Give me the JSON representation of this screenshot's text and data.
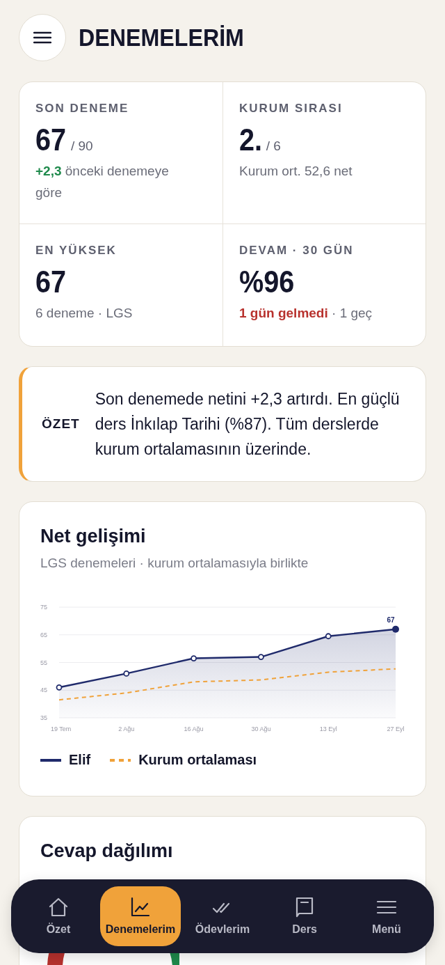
{
  "header": {
    "title": "DENEMELERİM"
  },
  "stats": [
    {
      "label": "SON DENEME",
      "value": "67",
      "suffix": "/ 90",
      "note": {
        "good": "+2,3",
        "text": "önceki denemeye göre"
      }
    },
    {
      "label": "KURUM SIRASI",
      "value": "2.",
      "suffix": "/ 6",
      "note": {
        "text": "Kurum ort. 52,6 net"
      }
    },
    {
      "label": "EN YÜKSEK",
      "value": "67",
      "note": {
        "text": "6 deneme · LGS"
      }
    },
    {
      "label": "DEVAM · 30 GÜN",
      "value": "%96",
      "note": {
        "bad": "1 gün gelmedi",
        "text": "· 1 geç"
      }
    }
  ],
  "summary": {
    "label": "ÖZET",
    "text": "Son denemede netini +2,3 artırdı. En güçlü ders İnkılap Tarihi (%87). Tüm derslerde kurum ortalamasının üzerinde."
  },
  "progress_card": {
    "title": "Net gelişimi",
    "subtitle": "LGS denemeleri · kurum ortalamasıyla birlikte",
    "chart_data": {
      "type": "line",
      "grid": true,
      "categories": [
        "19 Tem",
        "2 Ağu",
        "16 Ağu",
        "30 Ağu",
        "13 Eyl",
        "27 Eyl"
      ],
      "ylim": [
        35,
        75
      ],
      "yticks": [
        35,
        45,
        55,
        65,
        75
      ],
      "series": [
        {
          "name": "Elif",
          "color": "#1f2a6b",
          "type": "area",
          "marker": "o",
          "line_style": "solid",
          "values": [
            46,
            51,
            56.5,
            57,
            64.5,
            67
          ]
        },
        {
          "name": "Kurum ortalaması",
          "color": "#f0a23a",
          "type": "line",
          "line_style": "dashed",
          "values": [
            41.5,
            44,
            48,
            48.7,
            51.5,
            52.7
          ]
        }
      ],
      "annotations": [
        {
          "x": "27 Eyl",
          "y": 67,
          "text": "67"
        }
      ]
    }
  },
  "answers_card": {
    "title": "Cevap dağılımı"
  },
  "bottom_nav": [
    {
      "label": "Özet",
      "selected": false
    },
    {
      "label": "Denemelerim",
      "selected": true
    },
    {
      "label": "Ödevlerim",
      "selected": false
    },
    {
      "label": "Ders",
      "selected": false
    },
    {
      "label": "Menü",
      "selected": false
    }
  ]
}
